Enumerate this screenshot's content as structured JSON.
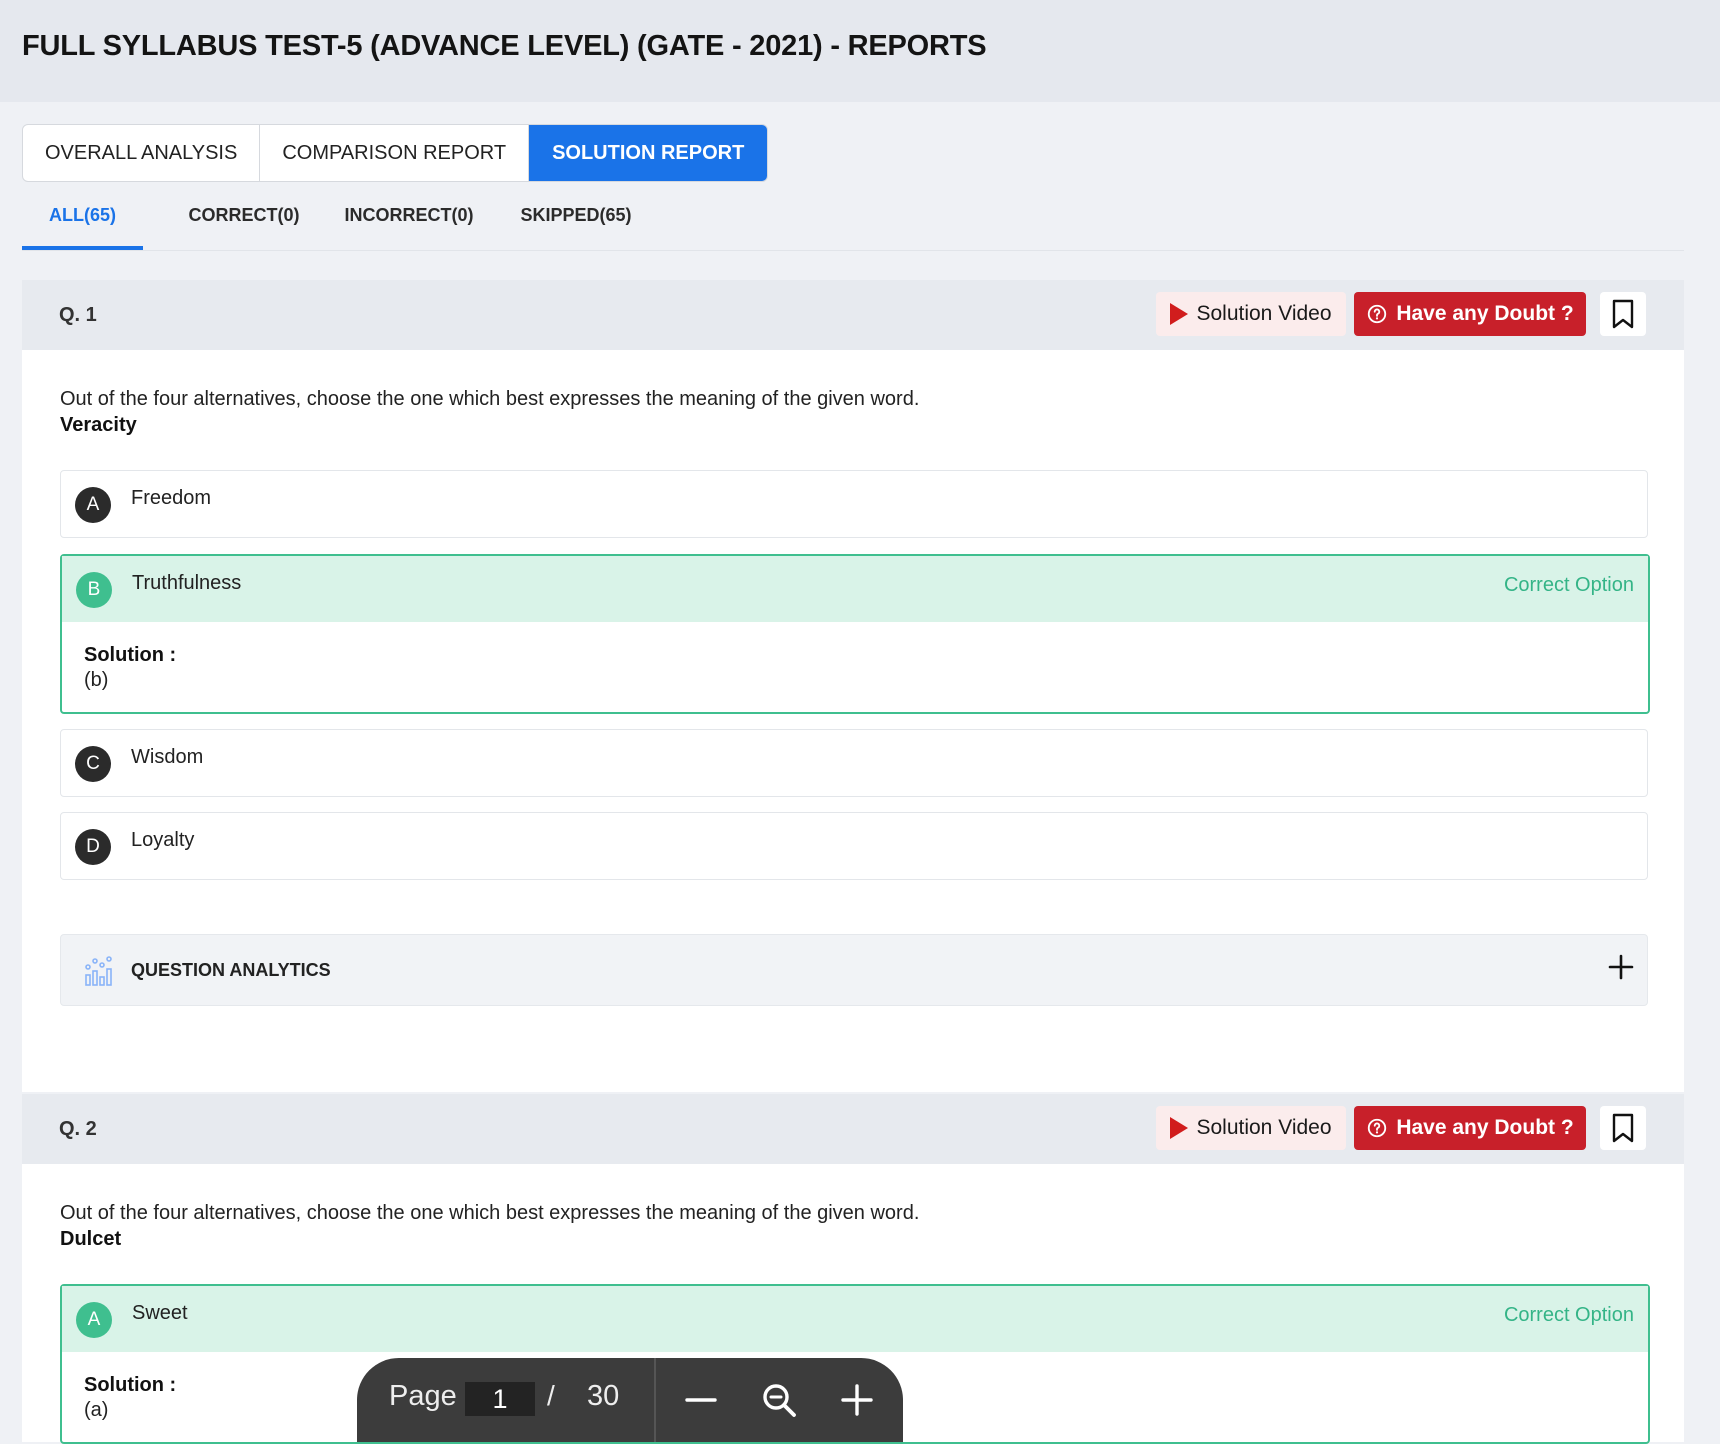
{
  "header": {
    "title": "FULL SYLLABUS TEST-5 (ADVANCE LEVEL) (GATE - 2021) - REPORTS"
  },
  "tabs": [
    {
      "label": "OVERALL ANALYSIS",
      "active": false
    },
    {
      "label": "COMPARISON REPORT",
      "active": false
    },
    {
      "label": "SOLUTION REPORT",
      "active": true
    }
  ],
  "filters": [
    {
      "label": "ALL(65)",
      "active": true
    },
    {
      "label": "CORRECT(0)",
      "active": false
    },
    {
      "label": "INCORRECT(0)",
      "active": false
    },
    {
      "label": "SKIPPED(65)",
      "active": false
    }
  ],
  "actions": {
    "solution_video": "Solution Video",
    "doubt": "Have any Doubt ?",
    "video_icon": "play-icon",
    "doubt_icon": "question-bubble-icon",
    "bookmark_icon": "bookmark-icon"
  },
  "questions": [
    {
      "number": "Q. 1",
      "text": "Out of the four alternatives, choose the one which best expresses the meaning of the given word.",
      "word": "Veracity",
      "options": [
        {
          "letter": "A",
          "text": "Freedom"
        },
        {
          "letter": "B",
          "text": "Truthfulness",
          "correct": true
        },
        {
          "letter": "C",
          "text": "Wisdom"
        },
        {
          "letter": "D",
          "text": "Loyalty"
        }
      ],
      "correct_label": "Correct Option",
      "solution_label": "Solution :",
      "solution_value": "(b)",
      "analytics_label": "QUESTION ANALYTICS"
    },
    {
      "number": "Q. 2",
      "text": "Out of the four alternatives, choose the one which best expresses the meaning of the given word.",
      "word": "Dulcet",
      "options": [
        {
          "letter": "A",
          "text": "Sweet",
          "correct": true
        }
      ],
      "correct_label": "Correct Option",
      "solution_label": "Solution :",
      "solution_value": "(a)"
    }
  ],
  "pager": {
    "label": "Page",
    "current": "1",
    "separator": "/",
    "total": "30"
  },
  "colors": {
    "accent": "#1a73e8",
    "doubt_red": "#c8202a",
    "correct_green": "#3fbf8f",
    "correct_bg": "#d9f3e8"
  }
}
